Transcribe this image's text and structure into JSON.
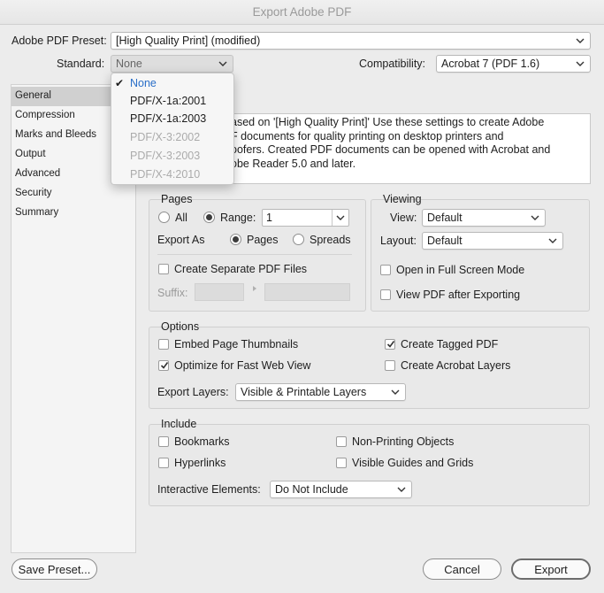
{
  "window": {
    "title": "Export Adobe PDF"
  },
  "preset": {
    "label": "Adobe PDF Preset:",
    "value": "[High Quality Print] (modified)"
  },
  "standard": {
    "label": "Standard:",
    "value": "None",
    "options": [
      {
        "label": "None",
        "selected": true,
        "enabled": true
      },
      {
        "label": "PDF/X-1a:2001",
        "selected": false,
        "enabled": true
      },
      {
        "label": "PDF/X-1a:2003",
        "selected": false,
        "enabled": true
      },
      {
        "label": "PDF/X-3:2002",
        "selected": false,
        "enabled": false
      },
      {
        "label": "PDF/X-3:2003",
        "selected": false,
        "enabled": false
      },
      {
        "label": "PDF/X-4:2010",
        "selected": false,
        "enabled": false
      }
    ]
  },
  "compatibility": {
    "label": "Compatibility:",
    "value": "Acrobat 7 (PDF 1.6)"
  },
  "sidebar": {
    "items": [
      {
        "label": "General",
        "selected": true
      },
      {
        "label": "Compression",
        "selected": false
      },
      {
        "label": "Marks and Bleeds",
        "selected": false
      },
      {
        "label": "Output",
        "selected": false
      },
      {
        "label": "Advanced",
        "selected": false
      },
      {
        "label": "Security",
        "selected": false
      },
      {
        "label": "Summary",
        "selected": false
      }
    ]
  },
  "description": {
    "line1": "ased on '[High Quality Print]' Use these settings to create Adobe",
    "line2": "F documents for quality printing on desktop printers and",
    "line3": "oofers.  Created PDF documents can be opened with Acrobat and",
    "line4": "obe Reader 5.0 and later."
  },
  "pages": {
    "title": "Pages",
    "all_label": "All",
    "range_label": "Range:",
    "range_value": "1",
    "export_as_label": "Export As",
    "pages_label": "Pages",
    "spreads_label": "Spreads",
    "separate_label": "Create Separate PDF Files",
    "suffix_label": "Suffix:"
  },
  "viewing": {
    "title": "Viewing",
    "view_label": "View:",
    "view_value": "Default",
    "layout_label": "Layout:",
    "layout_value": "Default",
    "fullscreen_label": "Open in Full Screen Mode",
    "after_export_label": "View PDF after Exporting"
  },
  "options": {
    "title": "Options",
    "thumbnails_label": "Embed Page Thumbnails",
    "fastweb_label": "Optimize for Fast Web View",
    "tagged_label": "Create Tagged PDF",
    "acrobat_layers_label": "Create Acrobat Layers",
    "export_layers_label": "Export Layers:",
    "export_layers_value": "Visible & Printable Layers"
  },
  "include": {
    "title": "Include",
    "bookmarks_label": "Bookmarks",
    "hyperlinks_label": "Hyperlinks",
    "nonprinting_label": "Non-Printing Objects",
    "guides_label": "Visible Guides and Grids",
    "interactive_label": "Interactive Elements:",
    "interactive_value": "Do Not Include"
  },
  "buttons": {
    "save_preset": "Save Preset...",
    "cancel": "Cancel",
    "export": "Export"
  }
}
